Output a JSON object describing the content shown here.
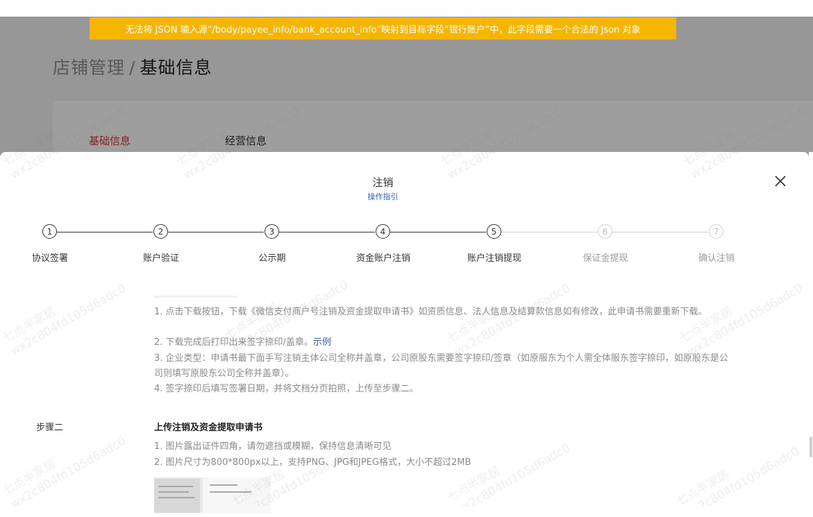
{
  "error_banner": "无法将 JSON 输入源“/body/payee_info/bank_account_info”映射到目标字段“银行账户”中，此字段需要一个合法的 Json 对象",
  "breadcrumb": {
    "parent": "店铺管理",
    "separator": "/",
    "current": "基础信息"
  },
  "page_tabs": [
    {
      "label": "基础信息",
      "active": true
    },
    {
      "label": "经营信息",
      "active": false
    }
  ],
  "modal": {
    "title": "注销",
    "guide_link": "操作指引",
    "close_icon": "close-icon",
    "steps": [
      {
        "number": "1",
        "label": "协议签署",
        "state": "done"
      },
      {
        "number": "2",
        "label": "账户验证",
        "state": "done"
      },
      {
        "number": "3",
        "label": "公示期",
        "state": "done"
      },
      {
        "number": "4",
        "label": "资金账户注销",
        "state": "done"
      },
      {
        "number": "5",
        "label": "账户注销提现",
        "state": "current"
      },
      {
        "number": "6",
        "label": "保证金提现",
        "state": "todo"
      },
      {
        "number": "7",
        "label": "确认注销",
        "state": "todo"
      }
    ],
    "step1_instructions": {
      "line1": "1. 点击下载按钮，下载《微信支付商户号注销及资金提取申请书》如资质信息、法人信息及结算款信息如有修改，此申请书需要重新下载。",
      "line2_text": "2. 下载完成后打印出来签字捺印/盖章。",
      "line2_link": "示例",
      "line3": "3. 企业类型：申请书最下面手写注销主体公司全称并盖章，公司原股东需要签字捺印/签章（如原服东为个人需全体服东签字捺印，如原股东是公司则填写原股东公司全称并盖章）。",
      "line4": "4. 签字捺印后填写签署日期，并将文档分页拍照，上传至步骤二。"
    },
    "step2": {
      "label": "步骤二",
      "title": "上传注销及资金提取申请书",
      "line1": "1. 图片露出证件四角，请勿遮挡或模糊，保持信息清晰可见",
      "line2": "2. 图片尺寸为800*800px以上，支持PNG、JPG和JPEG格式，大小不超过2MB"
    }
  },
  "watermark": {
    "line1": "七点半家居",
    "line2": "wx2c804fd105d6adc0"
  },
  "colors": {
    "banner": "#f6b500",
    "active_tab": "#d9363e",
    "link": "#3e5c9a"
  }
}
